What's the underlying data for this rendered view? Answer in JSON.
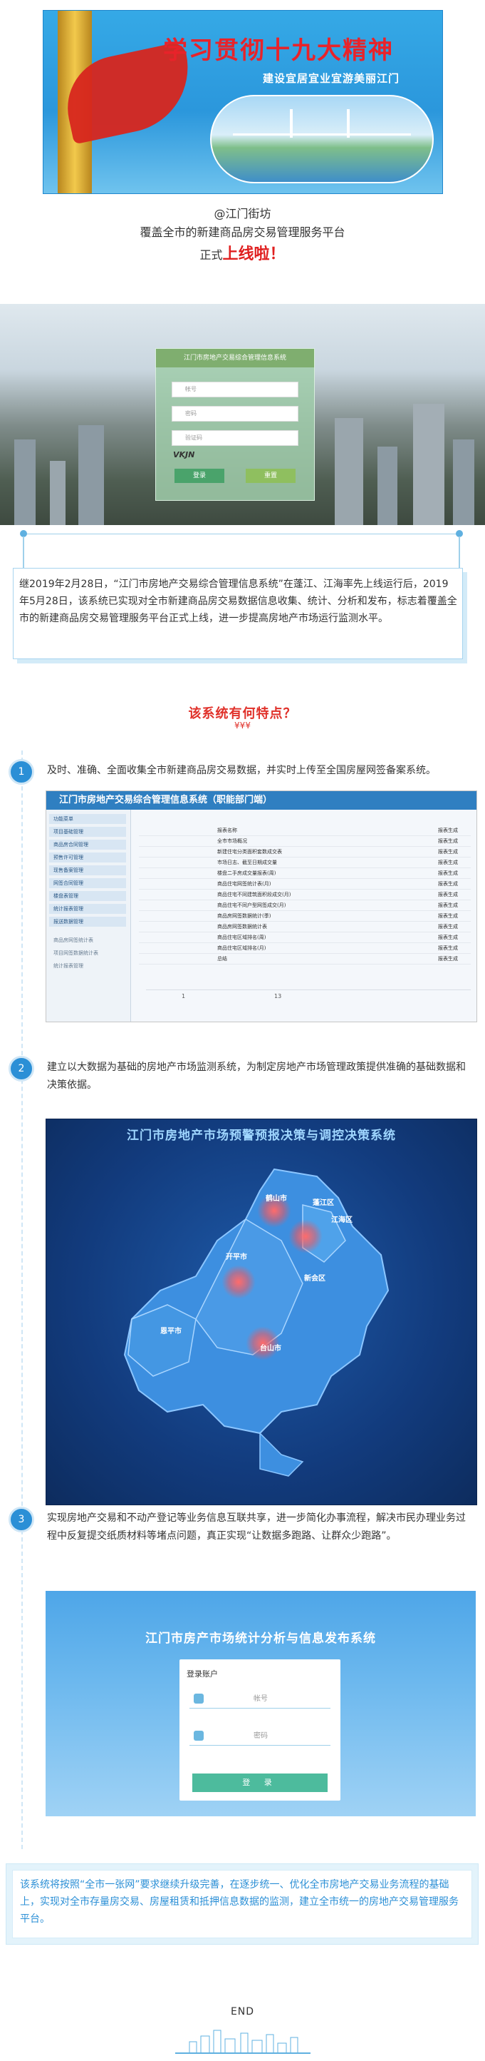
{
  "banner": {
    "title": "学习贯彻十九大精神",
    "subtitle": "建设宜居宜业宜游美丽江门"
  },
  "intro": {
    "handle": "@江门街坊",
    "line1": "覆盖全市的新建商品房交易管理服务平台",
    "line2_prefix": "正式",
    "line2_highlight": "上线啦！"
  },
  "login_screenshot": {
    "panel_title": "江门市房地产交易综合管理信息系统",
    "username_placeholder": "帐号",
    "password_placeholder": "密码",
    "captcha_placeholder": "验证码",
    "captcha_code": "VKJN",
    "login_button": "登录",
    "reset_button": "重置"
  },
  "paragraph1": "继2019年2月28日，“江门市房地产交易综合管理信息系统”在蓬江、江海率先上线运行后，2019年5月28日，该系统已实现对全市新建商品房交易数据信息收集、统计、分析和发布，标志着覆盖全市的新建商品房交易管理服务平台正式上线，进一步提高房地产市场运行监测水平。",
  "features": {
    "heading": "该系统有何特点？",
    "arrows": "¥¥¥",
    "items": [
      {
        "num": "1",
        "text": "及时、准确、全面收集全市新建商品房交易数据，并实时上传至全国房屋网签备案系统。"
      },
      {
        "num": "2",
        "text": "建立以大数据为基础的房地产市场监测系统，为制定房地产市场管理政策提供准确的基础数据和决策依据。"
      },
      {
        "num": "3",
        "text": "实现房地产交易和不动产登记等业务信息互联共享，进一步简化办事流程，解决市民办理业务过程中反复提交纸质材料等堵点问题，真正实现“让数据多跑路、让群众少跑路”。"
      }
    ]
  },
  "system_screenshot": {
    "title": "江门市房地产交易综合管理信息系统（职能部门端）",
    "sidebar": [
      "功能菜单",
      "项目基础管理",
      "商品房合同管理",
      "预售许可管理",
      "现售备案管理",
      "网签合同管理",
      "楼盘表管理",
      "统计报表管理",
      "报送数据管理"
    ],
    "sublinks": [
      "商品房网签统计表",
      "项目网签数据统计表",
      "统计报表管理"
    ],
    "rows": [
      "报表名称",
      "全市市场概况",
      "新建住宅分类面积套数成交表",
      "市场日志、截至日期成交量",
      "楼盘二手房成交量报表(周)",
      "商品住宅网签统计表(月)",
      "商品住宅不同建筑面积段成交(月)",
      "商品住宅不同户型网签成交(月)",
      "商品房网签数据统计(季)",
      "商品房网签数据统计表",
      "商品住宅区域排名(周)",
      "商品住宅区域排名(月)",
      "总结"
    ],
    "status_col": "报表生成",
    "pager": "1",
    "page_size": "13"
  },
  "map_screenshot": {
    "title": "江门市房地产市场预警预报决策与调控决策系统",
    "cities": [
      "鹤山市",
      "蓬江区",
      "江海区",
      "开平市",
      "新会区",
      "恩平市",
      "台山市"
    ]
  },
  "stat_screenshot": {
    "title": "江门市房产市场统计分析与信息发布系统",
    "card_title": "登录账户",
    "username_placeholder": "帐号",
    "password_placeholder": "密码",
    "login_button": "登 录"
  },
  "paragraph2": "该系统将按照“全市一张网”要求继续升级完善，在逐步统一、优化全市房地产交易业务流程的基础上，实现对全市存量房交易、房屋租赁和抵押信息数据的监测，建立全市统一的房地产交易管理服务平台。",
  "end_label": "END",
  "colors": {
    "accent_blue": "#2b8fd6",
    "highlight_red": "#e02020",
    "border_light_blue": "#a7d4ef"
  }
}
